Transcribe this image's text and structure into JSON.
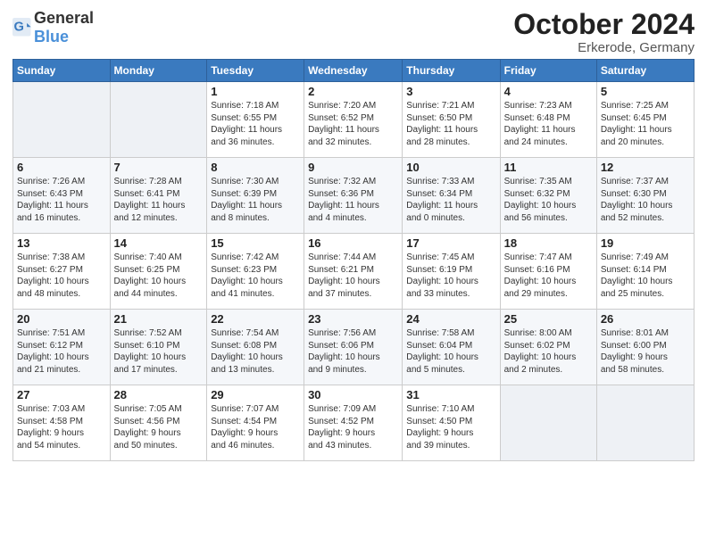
{
  "header": {
    "logo_general": "General",
    "logo_blue": "Blue",
    "month_title": "October 2024",
    "location": "Erkerode, Germany"
  },
  "weekdays": [
    "Sunday",
    "Monday",
    "Tuesday",
    "Wednesday",
    "Thursday",
    "Friday",
    "Saturday"
  ],
  "weeks": [
    [
      {
        "day": "",
        "content": ""
      },
      {
        "day": "",
        "content": ""
      },
      {
        "day": "1",
        "content": "Sunrise: 7:18 AM\nSunset: 6:55 PM\nDaylight: 11 hours\nand 36 minutes."
      },
      {
        "day": "2",
        "content": "Sunrise: 7:20 AM\nSunset: 6:52 PM\nDaylight: 11 hours\nand 32 minutes."
      },
      {
        "day": "3",
        "content": "Sunrise: 7:21 AM\nSunset: 6:50 PM\nDaylight: 11 hours\nand 28 minutes."
      },
      {
        "day": "4",
        "content": "Sunrise: 7:23 AM\nSunset: 6:48 PM\nDaylight: 11 hours\nand 24 minutes."
      },
      {
        "day": "5",
        "content": "Sunrise: 7:25 AM\nSunset: 6:45 PM\nDaylight: 11 hours\nand 20 minutes."
      }
    ],
    [
      {
        "day": "6",
        "content": "Sunrise: 7:26 AM\nSunset: 6:43 PM\nDaylight: 11 hours\nand 16 minutes."
      },
      {
        "day": "7",
        "content": "Sunrise: 7:28 AM\nSunset: 6:41 PM\nDaylight: 11 hours\nand 12 minutes."
      },
      {
        "day": "8",
        "content": "Sunrise: 7:30 AM\nSunset: 6:39 PM\nDaylight: 11 hours\nand 8 minutes."
      },
      {
        "day": "9",
        "content": "Sunrise: 7:32 AM\nSunset: 6:36 PM\nDaylight: 11 hours\nand 4 minutes."
      },
      {
        "day": "10",
        "content": "Sunrise: 7:33 AM\nSunset: 6:34 PM\nDaylight: 11 hours\nand 0 minutes."
      },
      {
        "day": "11",
        "content": "Sunrise: 7:35 AM\nSunset: 6:32 PM\nDaylight: 10 hours\nand 56 minutes."
      },
      {
        "day": "12",
        "content": "Sunrise: 7:37 AM\nSunset: 6:30 PM\nDaylight: 10 hours\nand 52 minutes."
      }
    ],
    [
      {
        "day": "13",
        "content": "Sunrise: 7:38 AM\nSunset: 6:27 PM\nDaylight: 10 hours\nand 48 minutes."
      },
      {
        "day": "14",
        "content": "Sunrise: 7:40 AM\nSunset: 6:25 PM\nDaylight: 10 hours\nand 44 minutes."
      },
      {
        "day": "15",
        "content": "Sunrise: 7:42 AM\nSunset: 6:23 PM\nDaylight: 10 hours\nand 41 minutes."
      },
      {
        "day": "16",
        "content": "Sunrise: 7:44 AM\nSunset: 6:21 PM\nDaylight: 10 hours\nand 37 minutes."
      },
      {
        "day": "17",
        "content": "Sunrise: 7:45 AM\nSunset: 6:19 PM\nDaylight: 10 hours\nand 33 minutes."
      },
      {
        "day": "18",
        "content": "Sunrise: 7:47 AM\nSunset: 6:16 PM\nDaylight: 10 hours\nand 29 minutes."
      },
      {
        "day": "19",
        "content": "Sunrise: 7:49 AM\nSunset: 6:14 PM\nDaylight: 10 hours\nand 25 minutes."
      }
    ],
    [
      {
        "day": "20",
        "content": "Sunrise: 7:51 AM\nSunset: 6:12 PM\nDaylight: 10 hours\nand 21 minutes."
      },
      {
        "day": "21",
        "content": "Sunrise: 7:52 AM\nSunset: 6:10 PM\nDaylight: 10 hours\nand 17 minutes."
      },
      {
        "day": "22",
        "content": "Sunrise: 7:54 AM\nSunset: 6:08 PM\nDaylight: 10 hours\nand 13 minutes."
      },
      {
        "day": "23",
        "content": "Sunrise: 7:56 AM\nSunset: 6:06 PM\nDaylight: 10 hours\nand 9 minutes."
      },
      {
        "day": "24",
        "content": "Sunrise: 7:58 AM\nSunset: 6:04 PM\nDaylight: 10 hours\nand 5 minutes."
      },
      {
        "day": "25",
        "content": "Sunrise: 8:00 AM\nSunset: 6:02 PM\nDaylight: 10 hours\nand 2 minutes."
      },
      {
        "day": "26",
        "content": "Sunrise: 8:01 AM\nSunset: 6:00 PM\nDaylight: 9 hours\nand 58 minutes."
      }
    ],
    [
      {
        "day": "27",
        "content": "Sunrise: 7:03 AM\nSunset: 4:58 PM\nDaylight: 9 hours\nand 54 minutes."
      },
      {
        "day": "28",
        "content": "Sunrise: 7:05 AM\nSunset: 4:56 PM\nDaylight: 9 hours\nand 50 minutes."
      },
      {
        "day": "29",
        "content": "Sunrise: 7:07 AM\nSunset: 4:54 PM\nDaylight: 9 hours\nand 46 minutes."
      },
      {
        "day": "30",
        "content": "Sunrise: 7:09 AM\nSunset: 4:52 PM\nDaylight: 9 hours\nand 43 minutes."
      },
      {
        "day": "31",
        "content": "Sunrise: 7:10 AM\nSunset: 4:50 PM\nDaylight: 9 hours\nand 39 minutes."
      },
      {
        "day": "",
        "content": ""
      },
      {
        "day": "",
        "content": ""
      }
    ]
  ]
}
